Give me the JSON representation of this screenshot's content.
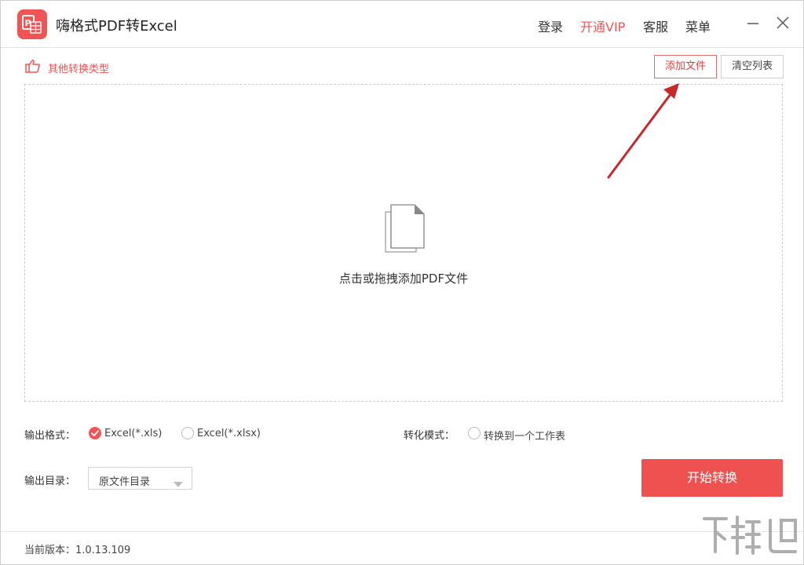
{
  "app": {
    "title": "嗨格式PDF转Excel"
  },
  "nav": {
    "login": "登录",
    "vip": "开通VIP",
    "service": "客服",
    "menu": "菜单"
  },
  "toolbar": {
    "other_types": "其他转换类型",
    "add_file": "添加文件",
    "clear_list": "清空列表"
  },
  "dropzone": {
    "hint": "点击或拖拽添加PDF文件"
  },
  "output_format": {
    "label": "输出格式：",
    "options": [
      "Excel(*.xls)",
      "Excel(*.xlsx)"
    ],
    "selected": "Excel(*.xls)"
  },
  "convert_mode": {
    "label": "转化模式：",
    "option": "转换到一个工作表",
    "checked": false
  },
  "output_dir": {
    "label": "输出目录：",
    "value": "原文件目录"
  },
  "start_button": "开始转换",
  "footer": {
    "version": "当前版本：1.0.13.109"
  },
  "colors": {
    "accent": "#f05454",
    "start_button": "#ef5050",
    "arrow": "#c8282a"
  },
  "icons": {
    "logo": "pdf-excel-logo-icon",
    "minimize": "minimize-icon",
    "close": "close-icon",
    "other_types": "thumbs-pointing-hand-icon",
    "file": "document-stack-icon",
    "check": "check-circle-icon",
    "caret": "caret-down-icon"
  }
}
